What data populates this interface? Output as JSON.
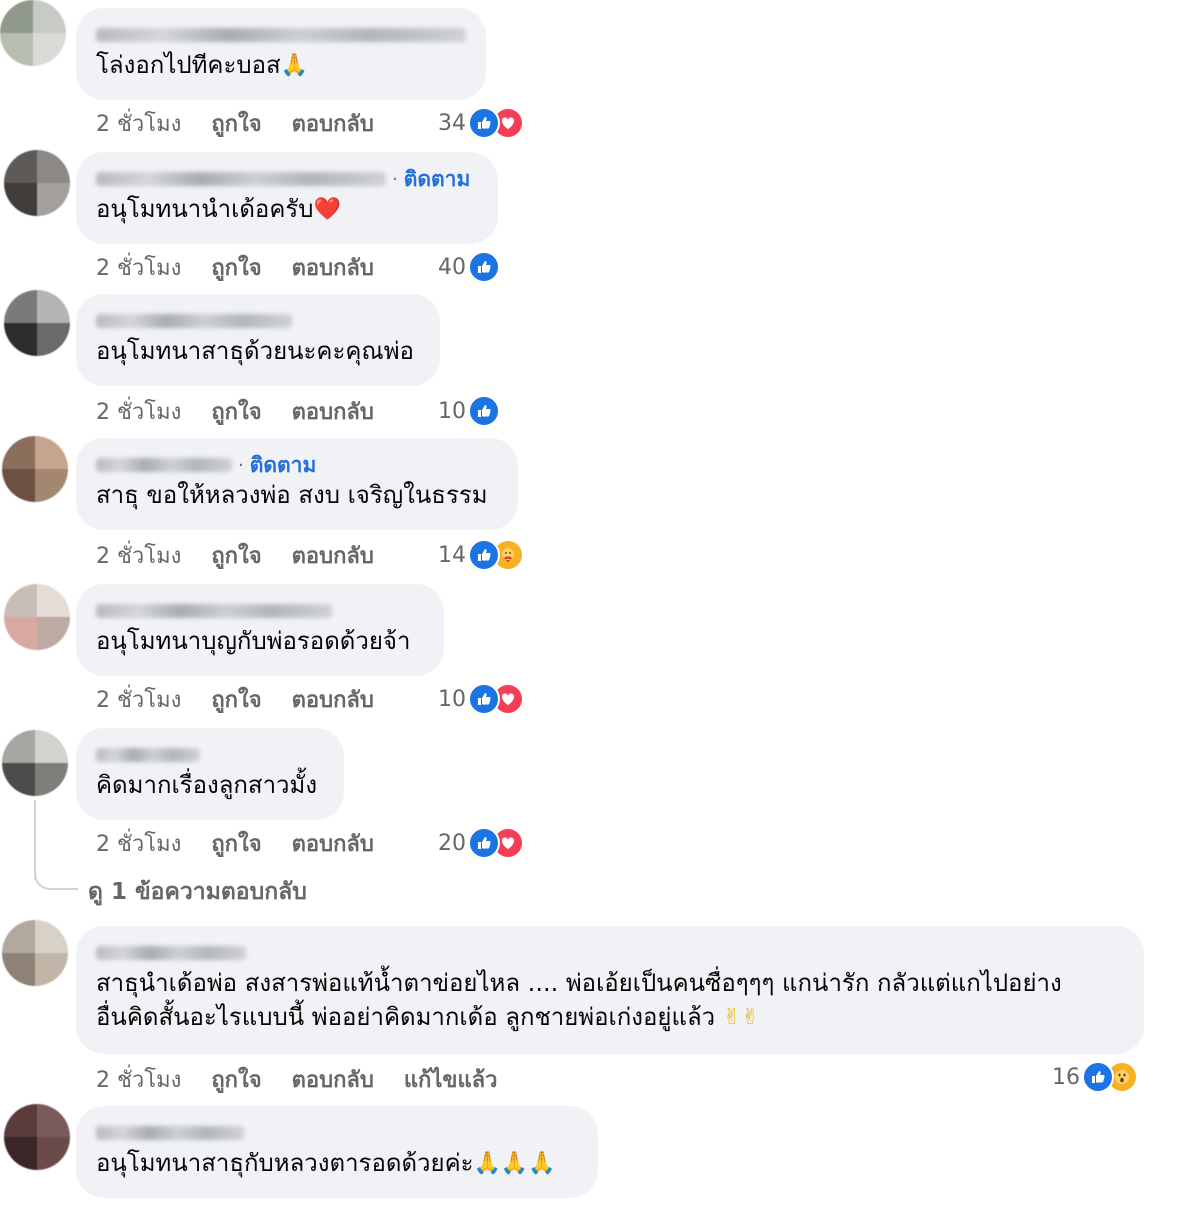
{
  "actions": {
    "like": "ถูกใจ",
    "reply": "ตอบกลับ"
  },
  "colors": {
    "bubble": "#f0f2f5",
    "follow": "#216fdb",
    "like": "#1b74e4",
    "love": "#f33e58",
    "care": "#f7b125",
    "secondary_text": "#65676b"
  },
  "comments": [
    {
      "time": "2 ชั่วโมง",
      "text": "โล่งอกไปทีคะบอส",
      "emoji": "🙏",
      "reaction_count": "34",
      "reactions": [
        "like-icon",
        "love-icon"
      ]
    },
    {
      "time": "2 ชั่วโมง",
      "follow": "ติดตาม",
      "text": "อนุโมทนานำเด้อครับ",
      "emoji": "❤️",
      "reaction_count": "40",
      "reactions": [
        "like-icon"
      ]
    },
    {
      "time": "2 ชั่วโมง",
      "text": "อนุโมทนาสาธุด้วยนะคะคุณพ่อ",
      "reaction_count": "10",
      "reactions": [
        "like-icon"
      ]
    },
    {
      "time": "2 ชั่วโมง",
      "follow": "ติดตาม",
      "text": "สาธุ ขอให้หลวงพ่อ สงบ เจริญในธรรม",
      "reaction_count": "14",
      "reactions": [
        "like-icon",
        "care-icon"
      ]
    },
    {
      "time": "2 ชั่วโมง",
      "text": "อนุโมทนาบุญกับพ่อรอดด้วยจ้า",
      "reaction_count": "10",
      "reactions": [
        "like-icon",
        "love-icon"
      ]
    },
    {
      "time": "2 ชั่วโมง",
      "text": "คิดมากเรื่องลูกสาวมั้ง",
      "reaction_count": "20",
      "reactions": [
        "like-icon",
        "love-icon"
      ],
      "view_replies": "ดู 1 ข้อความตอบกลับ"
    },
    {
      "time": "2 ชั่วโมง",
      "text_line1": "สาธุนำเด้อพ่อ สงสารพ่อแท้น้ำตาข่อยไหล .... พ่อเอ้ยเป็นคนซื่อๆๆๆ แกน่ารัก กลัวแต่แกไปอย่าง",
      "text_line2": "อื่นคิดสั้นอะไรแบบนี้ พ่ออย่าคิดมากเด้อ ลูกชายพ่อเก่งอยู่แล้ว",
      "emoji": "✌✌",
      "edited": "แก้ไขแล้ว",
      "reaction_count": "16",
      "reactions": [
        "like-icon",
        "wow-icon"
      ]
    },
    {
      "text": "อนุโมทนาสาธุกับหลวงตารอดด้วยค่ะ",
      "emoji": "🙏🙏🙏"
    }
  ]
}
